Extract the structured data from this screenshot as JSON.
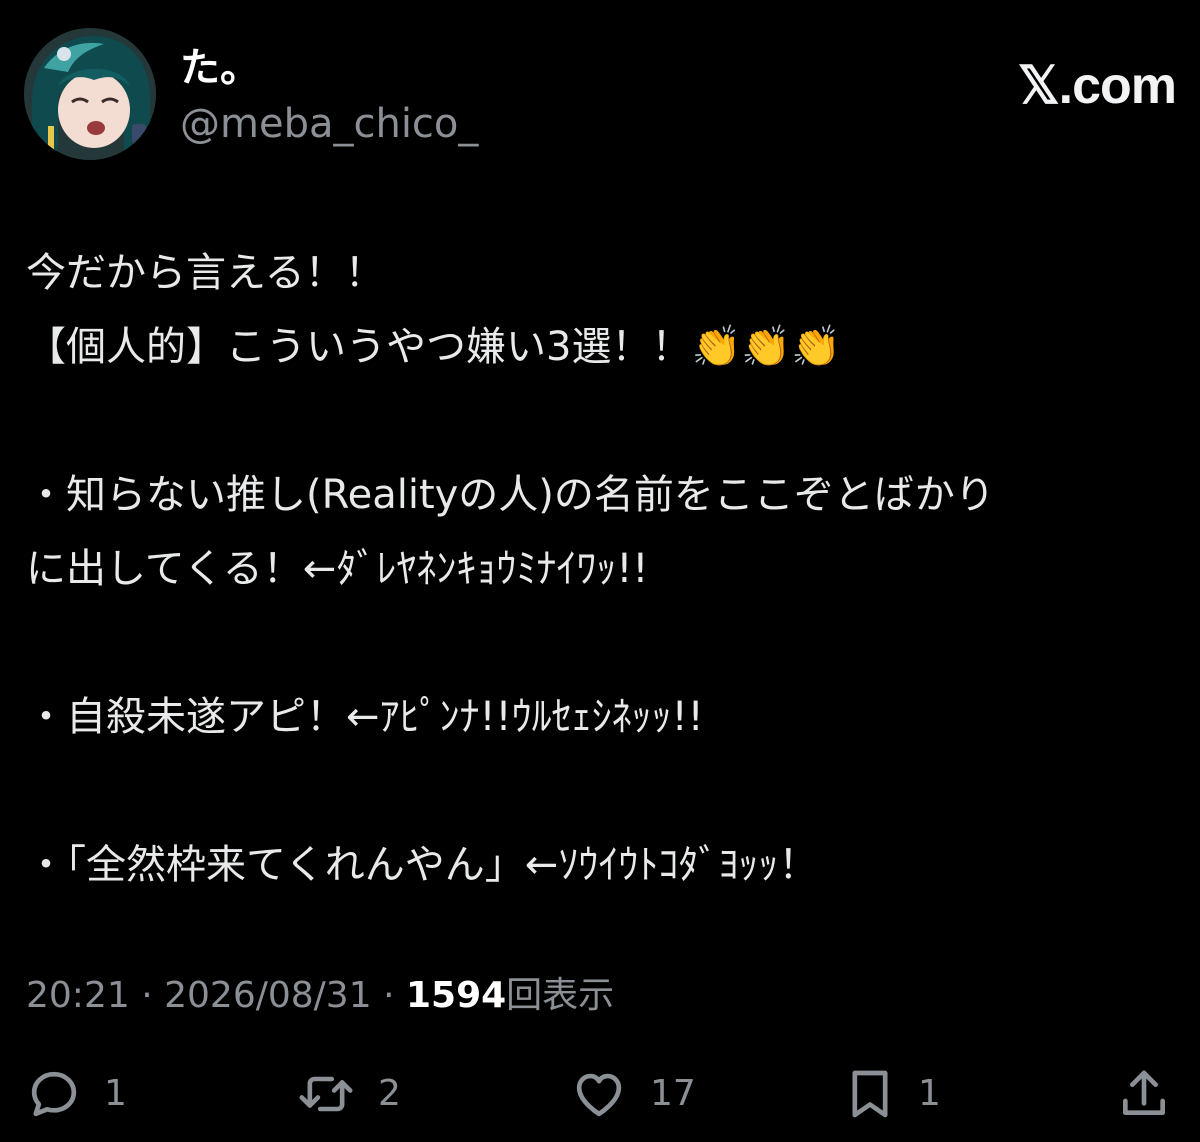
{
  "author": {
    "display_name": "た。",
    "handle": "@meba_chico_"
  },
  "brand": "𝕏.com",
  "tweet": {
    "lines": [
      "今だから言える！！",
      "【個人的】こういうやつ嫌い3選！！👏👏👏",
      "",
      "・知らない推し(Realityの人)の名前をここぞとばかり",
      "に出してくる！←ﾀﾞﾚﾔﾈﾝｷｮｳﾐﾅｲﾜｯ!!",
      "",
      "・自殺未遂アピ！←ｱﾋﾟﾝﾅ!!ｳﾙｾｪｼﾈｯｯ!!",
      "",
      "・「全然枠来てくれんやん」←ｿｳｲｳﾄｺﾀﾞﾖｯｯ！"
    ]
  },
  "meta": {
    "time": "20:21",
    "separator": "·",
    "date": "2026/08/31",
    "views_count": "1594",
    "views_label": "回表示"
  },
  "actions": {
    "reply_count": "1",
    "retweet_count": "2",
    "like_count": "17",
    "bookmark_count": "1"
  },
  "colors": {
    "background": "#000000",
    "text": "#e7e9ea",
    "secondary": "#8b9096"
  }
}
